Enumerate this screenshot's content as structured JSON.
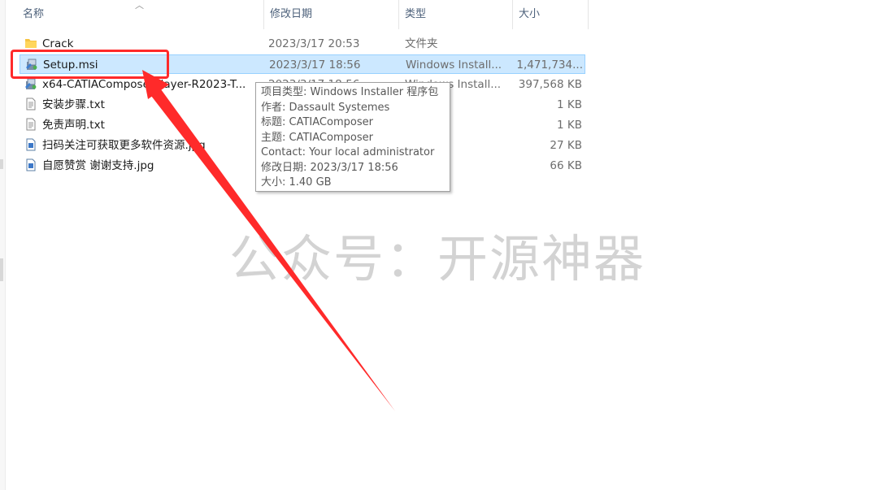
{
  "columns": {
    "name": "名称",
    "date": "修改日期",
    "type": "类型",
    "size": "大小"
  },
  "files": [
    {
      "name": "Crack",
      "date": "2023/3/17 20:53",
      "type": "文件夹",
      "size": "",
      "icon": "folder-icon"
    },
    {
      "name": "Setup.msi",
      "date": "2023/3/17 18:56",
      "type": "Windows Install...",
      "size": "1,471,734...",
      "icon": "msi-installer-icon",
      "selected": true
    },
    {
      "name": "x64-CATIAComposerPlayer-R2023-T...",
      "date": "2023/3/17 18:56",
      "type": "Windows Install...",
      "size": "397,568 KB",
      "icon": "msi-installer-icon"
    },
    {
      "name": "安装步骤.txt",
      "date": "",
      "type": "",
      "size": "1 KB",
      "icon": "text-file-icon"
    },
    {
      "name": "免责声明.txt",
      "date": "",
      "type": "",
      "size": "1 KB",
      "icon": "text-file-icon"
    },
    {
      "name": "扫码关注可获取更多软件资源.jpg",
      "date": "",
      "type": "",
      "size": "27 KB",
      "icon": "image-file-icon"
    },
    {
      "name": "自愿赞赏 谢谢支持.jpg",
      "date": "",
      "type": "",
      "size": "66 KB",
      "icon": "image-file-icon"
    }
  ],
  "tooltip": {
    "lines": [
      "项目类型: Windows Installer 程序包",
      "作者: Dassault Systemes",
      "标题: CATIAComposer",
      "主题: CATIAComposer",
      "Contact:  Your local administrator",
      "修改日期: 2023/3/17 18:56",
      "大小: 1.40 GB"
    ]
  },
  "watermark": "公众号：开源神器",
  "colors": {
    "selection": "#cce8ff",
    "annotation": "#ff2a2a",
    "header_text": "#4c607a"
  }
}
